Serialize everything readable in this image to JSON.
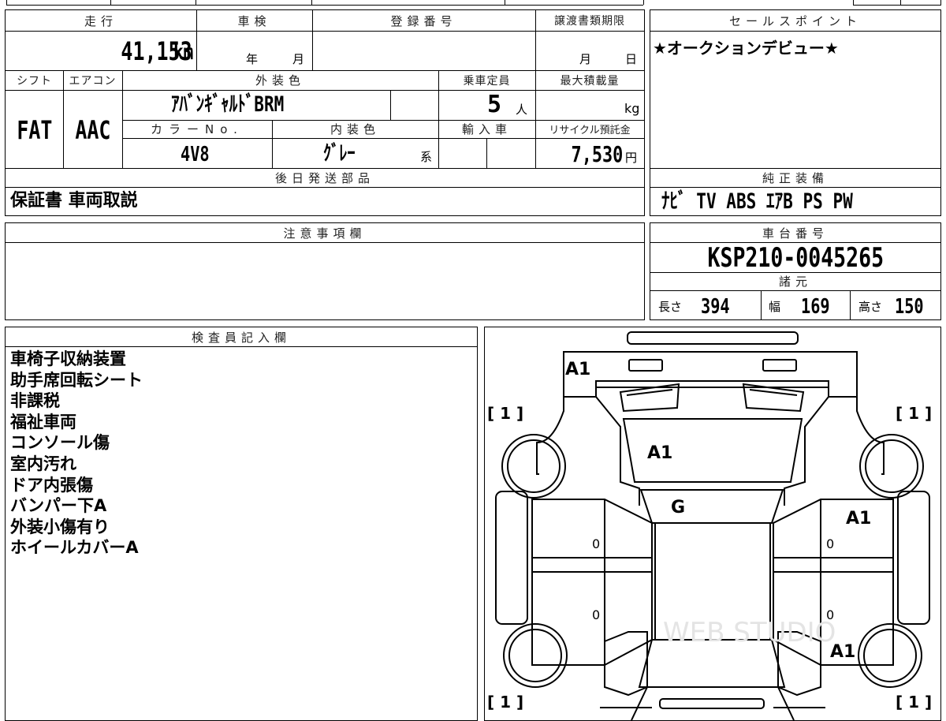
{
  "main_table": {
    "headers": {
      "mileage": "走行",
      "inspection": "車検",
      "registration_no": "登録番号",
      "transfer_deadline": "譲渡書類期限",
      "shift": "シフト",
      "aircon": "エアコン",
      "exterior_color": "外装色",
      "capacity": "乗車定員",
      "max_load": "最大積載量",
      "color_no": "カラーNo.",
      "interior_color": "内装色",
      "import": "輸入車",
      "recycle_fee": "リサイクル預託金",
      "shipping_parts": "後日発送部品"
    },
    "mileage_value": "41,153",
    "mileage_unit": "km",
    "inspection_year_unit": "年",
    "inspection_month_unit": "月",
    "transfer_month_unit": "月",
    "transfer_day_unit": "日",
    "shift_value": "FAT",
    "aircon_value": "AAC",
    "exterior_color_value": "ｱﾊﾞﾝｷﾞｬﾙﾄﾞBRM",
    "capacity_value": "5",
    "capacity_unit": "人",
    "max_load_unit": "kg",
    "color_no_value": "4V8",
    "interior_color_value": "ｸﾞﾚｰ",
    "interior_color_suffix": "系",
    "recycle_fee_value": "7,530",
    "recycle_fee_unit": "円",
    "shipping_parts_value": "保証書 車両取説"
  },
  "sales_point": {
    "header": "セールスポイント",
    "text": "★オークションデビュー★"
  },
  "equipment": {
    "header": "純正装備",
    "text": "ﾅﾋﾞ TV ABS ｴｱB PS PW"
  },
  "caution": {
    "header": "注意事項欄"
  },
  "chassis": {
    "header": "車台番号",
    "value": "KSP210-0045265"
  },
  "specs": {
    "header": "諸元",
    "length_label": "長さ",
    "length_value": "394",
    "width_label": "幅",
    "width_value": "169",
    "height_label": "高さ",
    "height_value": "150"
  },
  "inspector": {
    "header": "検査員記入欄",
    "notes": [
      "車椅子収納装置",
      "助手席回転シート",
      "非課税",
      "福祉車両",
      "コンソール傷",
      "室内汚れ",
      "ドア内張傷",
      "バンパー下A",
      "外装小傷有り",
      "ホイールカバーA"
    ]
  },
  "diagram": {
    "grades": {
      "rear_bumper": "A1",
      "rear_glass": "A1",
      "roof": "G",
      "right_rear_door": "A1",
      "right_front_fender": "A1"
    },
    "tire_left_top": "[ 1 ]",
    "tire_right_top": "[ 1 ]",
    "tire_left_bottom": "[ 1 ]",
    "tire_right_bottom": "[ 1 ]",
    "door_marks": [
      "0",
      "0",
      "0",
      "0"
    ],
    "watermark": "WEB STUDIO"
  }
}
